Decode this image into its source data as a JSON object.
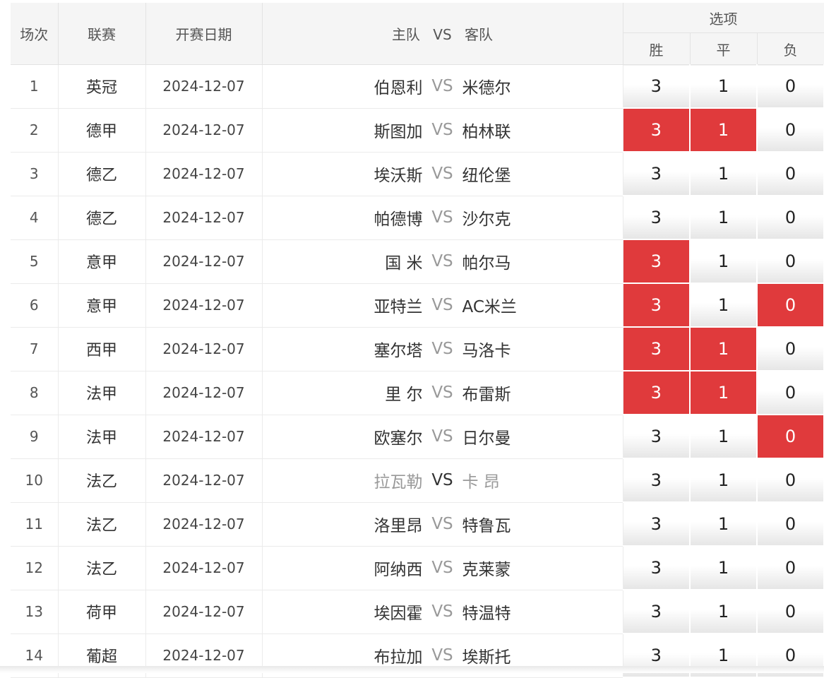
{
  "header": {
    "col_no": "场次",
    "col_league": "联赛",
    "col_date": "开赛日期",
    "col_match_home": "主队",
    "col_match_vs": "VS",
    "col_match_away": "客队",
    "col_options": "选项",
    "opt_win": "胜",
    "opt_draw": "平",
    "opt_lose": "负"
  },
  "colors": {
    "selected": "#e03a3c",
    "header_bg": "#f5f5f5"
  },
  "rows": [
    {
      "no": "1",
      "league": "英冠",
      "date": "2024-12-07",
      "home": "伯恩利",
      "vs": "VS",
      "away": "米德尔",
      "win": "3",
      "draw": "1",
      "lose": "0",
      "sel": []
    },
    {
      "no": "2",
      "league": "德甲",
      "date": "2024-12-07",
      "home": "斯图加",
      "vs": "VS",
      "away": "柏林联",
      "win": "3",
      "draw": "1",
      "lose": "0",
      "sel": [
        "win",
        "draw"
      ]
    },
    {
      "no": "3",
      "league": "德乙",
      "date": "2024-12-07",
      "home": "埃沃斯",
      "vs": "VS",
      "away": "纽伦堡",
      "win": "3",
      "draw": "1",
      "lose": "0",
      "sel": []
    },
    {
      "no": "4",
      "league": "德乙",
      "date": "2024-12-07",
      "home": "帕德博",
      "vs": "VS",
      "away": "沙尔克",
      "win": "3",
      "draw": "1",
      "lose": "0",
      "sel": []
    },
    {
      "no": "5",
      "league": "意甲",
      "date": "2024-12-07",
      "home": "国 米",
      "vs": "VS",
      "away": "帕尔马",
      "win": "3",
      "draw": "1",
      "lose": "0",
      "sel": [
        "win"
      ]
    },
    {
      "no": "6",
      "league": "意甲",
      "date": "2024-12-07",
      "home": "亚特兰",
      "vs": "VS",
      "away": "AC米兰",
      "win": "3",
      "draw": "1",
      "lose": "0",
      "sel": [
        "win",
        "lose"
      ]
    },
    {
      "no": "7",
      "league": "西甲",
      "date": "2024-12-07",
      "home": "塞尔塔",
      "vs": "VS",
      "away": "马洛卡",
      "win": "3",
      "draw": "1",
      "lose": "0",
      "sel": [
        "win",
        "draw"
      ]
    },
    {
      "no": "8",
      "league": "法甲",
      "date": "2024-12-07",
      "home": "里 尔",
      "vs": "VS",
      "away": "布雷斯",
      "win": "3",
      "draw": "1",
      "lose": "0",
      "sel": [
        "win",
        "draw"
      ]
    },
    {
      "no": "9",
      "league": "法甲",
      "date": "2024-12-07",
      "home": "欧塞尔",
      "vs": "VS",
      "away": "日尔曼",
      "win": "3",
      "draw": "1",
      "lose": "0",
      "sel": [
        "lose"
      ]
    },
    {
      "no": "10",
      "league": "法乙",
      "date": "2024-12-07",
      "home": "拉瓦勒",
      "vs": "VS",
      "away": "卡 昂",
      "win": "3",
      "draw": "1",
      "lose": "0",
      "sel": [],
      "dim": true
    },
    {
      "no": "11",
      "league": "法乙",
      "date": "2024-12-07",
      "home": "洛里昂",
      "vs": "VS",
      "away": "特鲁瓦",
      "win": "3",
      "draw": "1",
      "lose": "0",
      "sel": []
    },
    {
      "no": "12",
      "league": "法乙",
      "date": "2024-12-07",
      "home": "阿纳西",
      "vs": "VS",
      "away": "克莱蒙",
      "win": "3",
      "draw": "1",
      "lose": "0",
      "sel": []
    },
    {
      "no": "13",
      "league": "荷甲",
      "date": "2024-12-07",
      "home": "埃因霍",
      "vs": "VS",
      "away": "特温特",
      "win": "3",
      "draw": "1",
      "lose": "0",
      "sel": []
    },
    {
      "no": "14",
      "league": "葡超",
      "date": "2024-12-07",
      "home": "布拉加",
      "vs": "VS",
      "away": "埃斯托",
      "win": "3",
      "draw": "1",
      "lose": "0",
      "sel": []
    }
  ]
}
